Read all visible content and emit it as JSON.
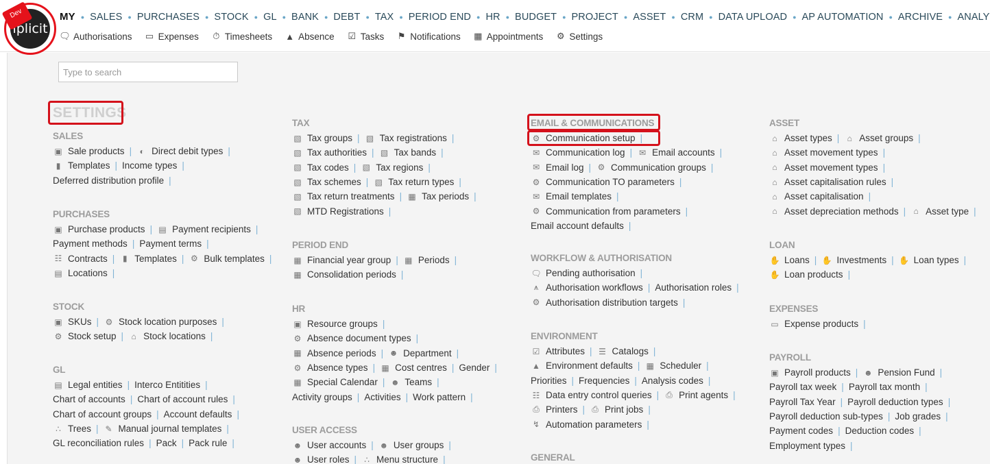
{
  "logo": {
    "text": "iplicit",
    "ribbon": "Dev"
  },
  "topnav": [
    "MY",
    "SALES",
    "PURCHASES",
    "STOCK",
    "GL",
    "BANK",
    "DEBT",
    "TAX",
    "PERIOD END",
    "HR",
    "BUDGET",
    "PROJECT",
    "ASSET",
    "CRM",
    "DATA UPLOAD",
    "AP AUTOMATION",
    "ARCHIVE",
    "ANALYTICS"
  ],
  "subnav": [
    {
      "label": "Authorisations",
      "icon": "chat-icon"
    },
    {
      "label": "Expenses",
      "icon": "card-icon"
    },
    {
      "label": "Timesheets",
      "icon": "timer-icon"
    },
    {
      "label": "Absence",
      "icon": "person-icon"
    },
    {
      "label": "Tasks",
      "icon": "check-icon"
    },
    {
      "label": "Notifications",
      "icon": "flag-icon"
    },
    {
      "label": "Appointments",
      "icon": "calendar-icon"
    },
    {
      "label": "Settings",
      "icon": "gear-icon"
    }
  ],
  "search": {
    "placeholder": "Type to search"
  },
  "page_title": "SETTINGS",
  "columns": [
    {
      "sections": [
        {
          "title": "SALES",
          "lines": [
            [
              {
                "label": "Sale products",
                "icon": "box-icon"
              },
              {
                "label": "Direct debit types",
                "icon": "half-circle-icon"
              }
            ],
            [
              {
                "label": "Templates",
                "icon": "doc-icon"
              },
              {
                "label": "Income types"
              }
            ],
            [
              {
                "label": "Deferred distribution profile"
              }
            ]
          ]
        },
        {
          "title": "PURCHASES",
          "lines": [
            [
              {
                "label": "Purchase products",
                "icon": "box-icon"
              },
              {
                "label": "Payment recipients",
                "icon": "building-icon"
              }
            ],
            [
              {
                "label": "Payment methods"
              },
              {
                "label": "Payment terms"
              }
            ],
            [
              {
                "label": "Contracts",
                "icon": "contract-icon"
              },
              {
                "label": "Templates",
                "icon": "doc-icon"
              },
              {
                "label": "Bulk templates",
                "icon": "gear-icon"
              }
            ],
            [
              {
                "label": "Locations",
                "icon": "building-icon"
              }
            ]
          ]
        },
        {
          "title": "STOCK",
          "lines": [
            [
              {
                "label": "SKUs",
                "icon": "box-icon"
              },
              {
                "label": "Stock location purposes",
                "icon": "gear-icon"
              }
            ],
            [
              {
                "label": "Stock setup",
                "icon": "gear-icon"
              },
              {
                "label": "Stock locations",
                "icon": "house-icon"
              }
            ]
          ]
        },
        {
          "title": "GL",
          "lines": [
            [
              {
                "label": "Legal entities",
                "icon": "building-icon"
              },
              {
                "label": "Interco Entitities"
              }
            ],
            [
              {
                "label": "Chart of accounts"
              },
              {
                "label": "Chart of account rules"
              }
            ],
            [
              {
                "label": "Chart of account groups"
              },
              {
                "label": "Account defaults"
              }
            ],
            [
              {
                "label": "Trees",
                "icon": "tree-icon"
              },
              {
                "label": "Manual journal templates",
                "icon": "pencil-icon"
              }
            ],
            [
              {
                "label": "GL reconciliation rules"
              },
              {
                "label": "Pack"
              },
              {
                "label": "Pack rule"
              }
            ]
          ]
        }
      ]
    },
    {
      "sections": [
        {
          "title": "TAX",
          "lines": [
            [
              {
                "label": "Tax groups",
                "icon": "tax-icon"
              },
              {
                "label": "Tax registrations",
                "icon": "tax-icon"
              }
            ],
            [
              {
                "label": "Tax authorities",
                "icon": "tax-icon"
              },
              {
                "label": "Tax bands",
                "icon": "tax-icon"
              }
            ],
            [
              {
                "label": "Tax codes",
                "icon": "tax-icon"
              },
              {
                "label": "Tax regions",
                "icon": "tax-icon"
              }
            ],
            [
              {
                "label": "Tax schemes",
                "icon": "tax-icon"
              },
              {
                "label": "Tax return types",
                "icon": "tax-icon"
              }
            ],
            [
              {
                "label": "Tax return treatments",
                "icon": "tax-icon"
              },
              {
                "label": "Tax periods",
                "icon": "calendar-icon"
              }
            ],
            [
              {
                "label": "MTD Registrations",
                "icon": "tax-icon"
              }
            ]
          ]
        },
        {
          "title": "PERIOD END",
          "lines": [
            [
              {
                "label": "Financial year group",
                "icon": "grid-icon"
              },
              {
                "label": "Periods",
                "icon": "calendar-icon"
              }
            ],
            [
              {
                "label": "Consolidation periods",
                "icon": "calendar-icon"
              }
            ]
          ]
        },
        {
          "title": "HR",
          "lines": [
            [
              {
                "label": "Resource groups",
                "icon": "box-icon"
              }
            ],
            [
              {
                "label": "Absence document types",
                "icon": "gear-icon"
              }
            ],
            [
              {
                "label": "Absence periods",
                "icon": "calendar-icon"
              },
              {
                "label": "Department",
                "icon": "people-icon"
              }
            ],
            [
              {
                "label": "Absence types",
                "icon": "gear-icon"
              },
              {
                "label": "Cost centres",
                "icon": "grid-icon"
              },
              {
                "label": "Gender"
              }
            ],
            [
              {
                "label": "Special Calendar",
                "icon": "calendar-icon"
              },
              {
                "label": "Teams",
                "icon": "people-icon"
              }
            ],
            [
              {
                "label": "Activity groups"
              },
              {
                "label": "Activities"
              },
              {
                "label": "Work pattern"
              }
            ]
          ]
        },
        {
          "title": "USER ACCESS",
          "lines": [
            [
              {
                "label": "User accounts",
                "icon": "people-icon"
              },
              {
                "label": "User groups",
                "icon": "people-icon"
              }
            ],
            [
              {
                "label": "User roles",
                "icon": "people-icon"
              },
              {
                "label": "Menu structure",
                "icon": "tree-icon"
              }
            ]
          ]
        }
      ]
    },
    {
      "sections": [
        {
          "title": "EMAIL & COMMUNICATIONS",
          "lines": [
            [
              {
                "label": "Communication setup",
                "icon": "gear-icon"
              }
            ],
            [
              {
                "label": "Communication log",
                "icon": "mail-icon"
              },
              {
                "label": "Email accounts",
                "icon": "mail-icon"
              }
            ],
            [
              {
                "label": "Email log",
                "icon": "mail-icon"
              },
              {
                "label": "Communication groups",
                "icon": "gear-icon"
              }
            ],
            [
              {
                "label": "Communication TO parameters",
                "icon": "gear-icon"
              }
            ],
            [
              {
                "label": "Email templates",
                "icon": "mail-icon"
              }
            ],
            [
              {
                "label": "Communication from parameters",
                "icon": "gear-icon"
              }
            ],
            [
              {
                "label": "Email account defaults"
              }
            ]
          ]
        },
        {
          "title": "WORKFLOW & AUTHORISATION",
          "lines": [
            [
              {
                "label": "Pending authorisation",
                "icon": "chat-icon"
              }
            ],
            [
              {
                "label": "Authorisation workflows",
                "icon": "workflow-icon"
              },
              {
                "label": "Authorisation roles"
              }
            ],
            [
              {
                "label": "Authorisation distribution targets",
                "icon": "gear-icon"
              }
            ]
          ]
        },
        {
          "title": "ENVIRONMENT",
          "lines": [
            [
              {
                "label": "Attributes",
                "icon": "check-icon"
              },
              {
                "label": "Catalogs",
                "icon": "list-icon"
              }
            ],
            [
              {
                "label": "Environment defaults",
                "icon": "person-icon"
              },
              {
                "label": "Scheduler",
                "icon": "calendar-icon"
              }
            ],
            [
              {
                "label": "Priorities"
              },
              {
                "label": "Frequencies"
              },
              {
                "label": "Analysis codes"
              }
            ],
            [
              {
                "label": "Data entry control queries",
                "icon": "query-icon"
              },
              {
                "label": "Print agents",
                "icon": "printer-icon"
              }
            ],
            [
              {
                "label": "Printers",
                "icon": "printer-icon"
              },
              {
                "label": "Print jobs",
                "icon": "printer-icon"
              }
            ],
            [
              {
                "label": "Automation parameters",
                "icon": "bolt-icon"
              }
            ]
          ]
        },
        {
          "title": "GENERAL",
          "lines": []
        }
      ]
    },
    {
      "sections": [
        {
          "title": "ASSET",
          "lines": [
            [
              {
                "label": "Asset types",
                "icon": "house-icon"
              },
              {
                "label": "Asset groups",
                "icon": "house-icon"
              }
            ],
            [
              {
                "label": "Asset movement types",
                "icon": "house-icon"
              }
            ],
            [
              {
                "label": "Asset movement types",
                "icon": "house-icon"
              }
            ],
            [
              {
                "label": "Asset capitalisation rules",
                "icon": "house-icon"
              }
            ],
            [
              {
                "label": "Asset capitalisation",
                "icon": "house-icon"
              }
            ],
            [
              {
                "label": "Asset depreciation methods",
                "icon": "house-icon"
              },
              {
                "label": "Asset type",
                "icon": "house-icon"
              }
            ]
          ]
        },
        {
          "title": "LOAN",
          "lines": [
            [
              {
                "label": "Loans",
                "icon": "hand-icon"
              },
              {
                "label": "Investments",
                "icon": "hand-icon"
              },
              {
                "label": "Loan types",
                "icon": "hand-icon"
              }
            ],
            [
              {
                "label": "Loan products",
                "icon": "hand-icon"
              }
            ]
          ]
        },
        {
          "title": "EXPENSES",
          "lines": [
            [
              {
                "label": "Expense products",
                "icon": "card-icon"
              }
            ]
          ]
        },
        {
          "title": "PAYROLL",
          "lines": [
            [
              {
                "label": "Payroll products",
                "icon": "box-icon"
              },
              {
                "label": "Pension Fund",
                "icon": "people-icon"
              }
            ],
            [
              {
                "label": "Payroll tax week"
              },
              {
                "label": "Payroll tax month"
              }
            ],
            [
              {
                "label": "Payroll Tax Year"
              },
              {
                "label": "Payroll deduction types"
              }
            ],
            [
              {
                "label": "Payroll deduction sub-types"
              },
              {
                "label": "Job grades"
              }
            ],
            [
              {
                "label": "Payment codes"
              },
              {
                "label": "Deduction codes"
              }
            ],
            [
              {
                "label": "Employment types"
              }
            ]
          ]
        }
      ]
    }
  ]
}
